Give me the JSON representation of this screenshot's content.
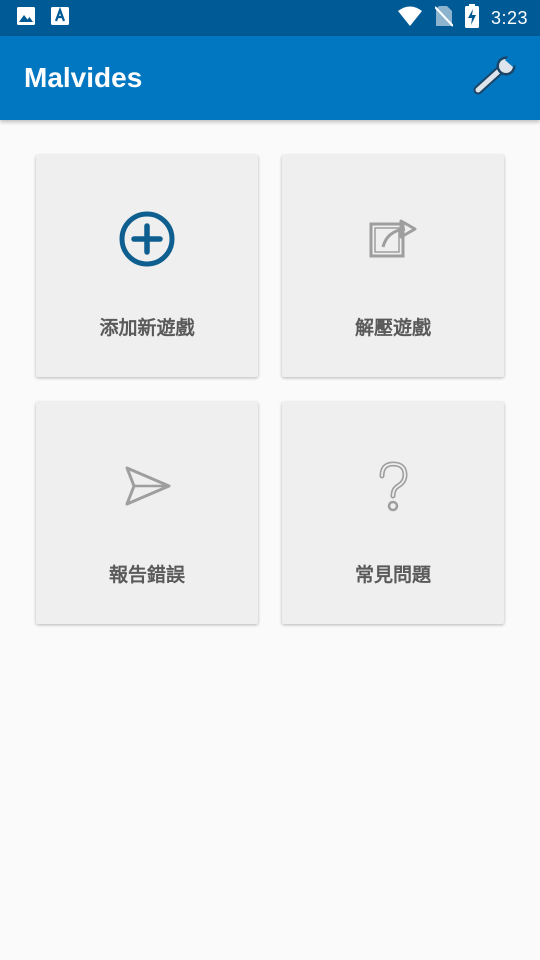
{
  "status_bar": {
    "time": "3:23",
    "left_icons": [
      "image-icon",
      "font-a-icon"
    ],
    "right_icons": [
      "wifi-icon",
      "no-sim-icon",
      "battery-charging-icon"
    ]
  },
  "app_bar": {
    "title": "Malvides",
    "settings_icon": "wrench-icon"
  },
  "colors": {
    "status_bar": "#005a95",
    "app_bar": "#0077c0",
    "background": "#fafafa",
    "tile": "#efefef",
    "accent_icon": "#0e5f8f",
    "muted_icon": "#9e9e9e",
    "label": "#5a5a5a"
  },
  "tiles": [
    {
      "label": "添加新遊戲",
      "icon": "add-circle-icon"
    },
    {
      "label": "解壓遊戲",
      "icon": "share-export-icon"
    },
    {
      "label": "報告錯誤",
      "icon": "send-icon"
    },
    {
      "label": "常見問題",
      "icon": "help-question-icon"
    }
  ]
}
